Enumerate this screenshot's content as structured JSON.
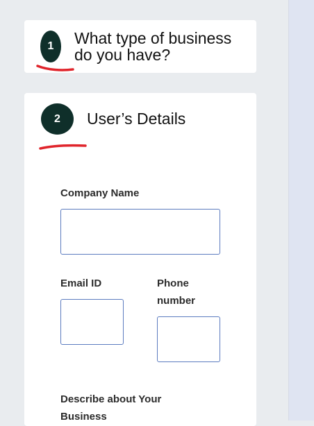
{
  "steps": [
    {
      "number": "1",
      "title": "What type of business do you have?"
    },
    {
      "number": "2",
      "title": "User’s Details"
    }
  ],
  "form": {
    "company_name_label": "Company Name",
    "company_name_value": "",
    "email_label": "Email ID",
    "email_value": "",
    "phone_label": "Phone number",
    "phone_value": "",
    "describe_label": "Describe about Your Business"
  },
  "colors": {
    "badge": "#0f2f2a",
    "annotation": "#e0242b",
    "input_border": "#5b7bbf",
    "page_bg": "#e9ecef"
  }
}
